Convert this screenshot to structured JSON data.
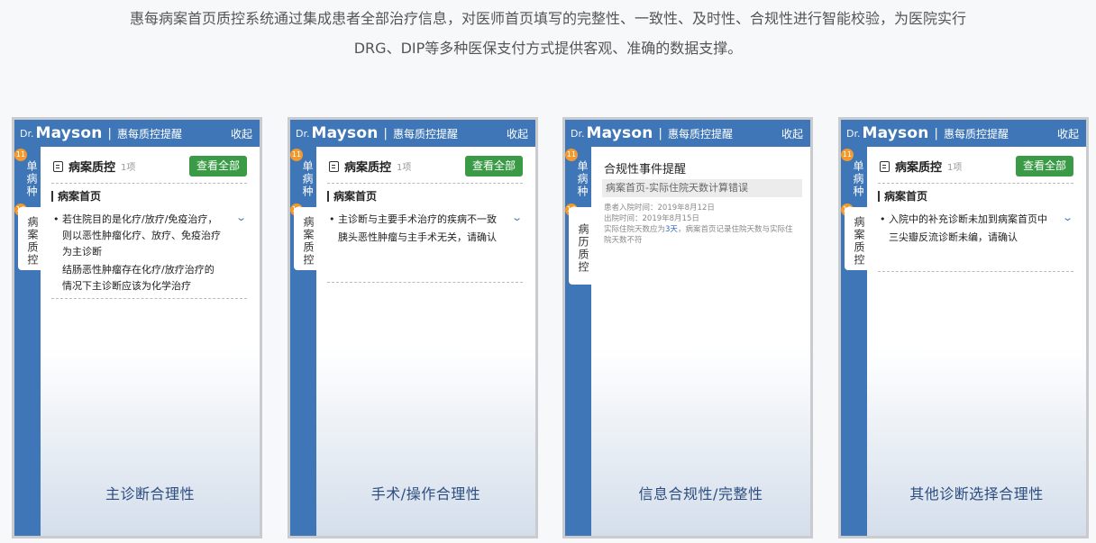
{
  "intro": {
    "line1": "惠每病案首页质控系统通过集成患者全部治疗信息，对医师首页填写的完整性、一致性、及时性、合规性进行智能校验，为医院实行",
    "line2": "DRG、DIP等多种医保支付方式提供客观、准确的数据支撑。"
  },
  "common": {
    "brand_prefix": "Dr.",
    "brand_name": "Mayson",
    "separator": "|",
    "header_title": "惠每质控提醒",
    "collapse_label": "收起",
    "tab1_badge": "11",
    "tab1_label": "单病种",
    "tab2_badge": "16",
    "qc_title": "病案质控",
    "qc_count": "1项",
    "view_all": "查看全部",
    "section_title": "病案首页",
    "bullet": "•",
    "chevron": "⌄",
    "chevron_icon": "chevron-down-icon",
    "qc_icon": "document-check-icon",
    "accent_color": "#3f76b7",
    "button_color": "#3a9a45",
    "badge_color": "#f29a2e"
  },
  "cards": [
    {
      "tab2_label": "病案质控",
      "item_text": "若住院目的是化疗/放疗/免疫治疗，则以恶性肿瘤化疗、放疗、免疫治疗为主诊断",
      "item_sub": "结肠恶性肿瘤存在化疗/放疗治疗的情况下主诊断应该为化学治疗",
      "footer": "主诊断合理性"
    },
    {
      "tab2_label": "病案质控",
      "item_text": "主诊断与主要手术治疗的疾病不一致",
      "item_sub": "胰头恶性肿瘤与主手术无关，请确认",
      "footer": "手术/操作合理性"
    },
    {
      "tab2_label": "病历质控",
      "event_title": "合规性事件提醒",
      "event_sub": "病案首页-实际住院天数计算错误",
      "admit_time": "患者入院时间：2019年8月12日",
      "discharge_time": "出院时间：2019年8月15日",
      "detail_before": "实际住院天数应为",
      "detail_highlight": "3天",
      "detail_after": "，病案首页记录住院天数与实际住院天数不符",
      "footer": "信息合规性/完整性"
    },
    {
      "tab2_label": "病案质控",
      "item_text": "入院中的补充诊断未加到病案首页中",
      "item_sub": "三尖瓣反流诊断未编，请确认",
      "footer": "其他诊断选择合理性"
    }
  ]
}
